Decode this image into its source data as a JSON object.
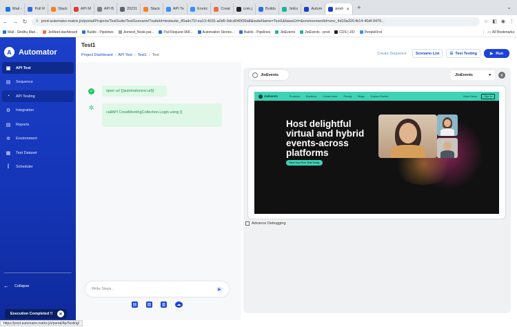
{
  "browser": {
    "tabs": [
      {
        "label": "Mail -",
        "color": "#1a73e8"
      },
      {
        "label": "Pull R",
        "color": "#2d6cdf"
      },
      {
        "label": "Stack",
        "color": "#f48024"
      },
      {
        "label": "API M",
        "color": "#e53935"
      },
      {
        "label": "API B",
        "color": "#7a7f87"
      },
      {
        "label": "20231",
        "color": "#5b6270"
      },
      {
        "label": "Stack",
        "color": "#f48024"
      },
      {
        "label": "API Te",
        "color": "#3d8bfd"
      },
      {
        "label": "Envirc",
        "color": "#3d8bfd"
      },
      {
        "label": "Creat",
        "color": "#f26b3a"
      },
      {
        "label": "com.j",
        "color": "#222222"
      },
      {
        "label": "Builds",
        "color": "#2d6cdf"
      },
      {
        "label": "JioEv",
        "color": "#20b39a"
      },
      {
        "label": "Autom",
        "color": "#1b3fc9"
      },
      {
        "label": "prod-",
        "color": "#1b3fc9",
        "active": true
      }
    ],
    "url": "prod-automator.matrix.jio/portal/Projects/TestSuite/TestScenario/?suiteId=testsuite_85adc71f-ea13-4031-a0d5-9dcd040f39a8&suiteName=Test1&baseUrl=&environmentId=env_4d10a320-fb14-40df-9476...",
    "bookmarks": [
      {
        "label": "Mail - Sindhu Man...",
        "color": "#1a73e8"
      },
      {
        "label": "JioMeet-dashboard",
        "color": "#f26b3a"
      },
      {
        "label": "Builds - Pipelines",
        "color": "#2d6cdf"
      },
      {
        "label": "Jiomeet_Node.pat...",
        "color": "#9aa0a6"
      },
      {
        "label": "Pull Request 968...",
        "color": "#2d6cdf"
      },
      {
        "label": "Automation Stories...",
        "color": "#2d6cdf"
      },
      {
        "label": "Builds - Pipelines",
        "color": "#2d6cdf"
      },
      {
        "label": "JioEvents",
        "color": "#20b39a"
      },
      {
        "label": "JioEvents - prod",
        "color": "#20b39a"
      },
      {
        "label": "CDS | JIO",
        "color": "#222222"
      },
      {
        "label": "PeopleFirst",
        "color": "#3d8bfd"
      }
    ],
    "all_bookmarks": "All Bookmarks",
    "status_url": "https://prod-automator.matrix.jio/portal/ApiTesting/"
  },
  "app": {
    "brand": "Automator",
    "nav": [
      {
        "label": "API Test",
        "icon": "api-test-icon",
        "glyph": "▣",
        "state": "active"
      },
      {
        "label": "Sequence",
        "icon": "sequence-icon",
        "glyph": "▤",
        "state": ""
      },
      {
        "label": "API Testing",
        "icon": "api-testing-icon",
        "glyph": "◔",
        "state": "semi"
      },
      {
        "label": "Integration",
        "icon": "integration-icon",
        "glyph": "⚙",
        "state": ""
      },
      {
        "label": "Reports",
        "icon": "reports-icon",
        "glyph": "▤",
        "state": ""
      },
      {
        "label": "Environment",
        "icon": "environment-icon",
        "glyph": "✲",
        "state": ""
      },
      {
        "label": "Test Dataset",
        "icon": "test-dataset-icon",
        "glyph": "▦",
        "state": ""
      },
      {
        "label": "Scheduler",
        "icon": "scheduler-icon",
        "glyph": "⫿",
        "state": ""
      }
    ],
    "collapse": "Collapse",
    "toast": "Execution Completed !!"
  },
  "header": {
    "title": "Test1",
    "breadcrumb": [
      "Project Dashboard",
      "API Test",
      "Test1",
      "Test"
    ],
    "create_sequence": "Create Sequence",
    "scenario_list": "Scenario List",
    "test_testing": "Test Testing",
    "run": "Run"
  },
  "steps": [
    {
      "text": "open url {{automatorenv.url}}",
      "status": "passed"
    },
    {
      "text": "callAPI CreatMeetingCollection.Login using {}",
      "status": "config"
    }
  ],
  "composer": {
    "placeholder": "Write Steps..."
  },
  "preview": {
    "env_chip": "JioEvents",
    "env_select": "JioEvents",
    "advance_debugging": "Advance Debugging",
    "site": {
      "logo": "JioEvents",
      "nav": [
        "Products",
        "Solutions",
        "Create more",
        "Pricing",
        "Blogs",
        "Explore Events"
      ],
      "right": [
        "Book Demo",
        "Sign In"
      ],
      "headline": "Host delightful virtual and hybrid events-across platforms",
      "cta": "Start Your Free Trial Today"
    }
  },
  "colors": {
    "sidebar": "#1b3fc9",
    "accent": "#1c44d6",
    "success": "#27c46a",
    "site_accent": "#3ed3b4"
  }
}
